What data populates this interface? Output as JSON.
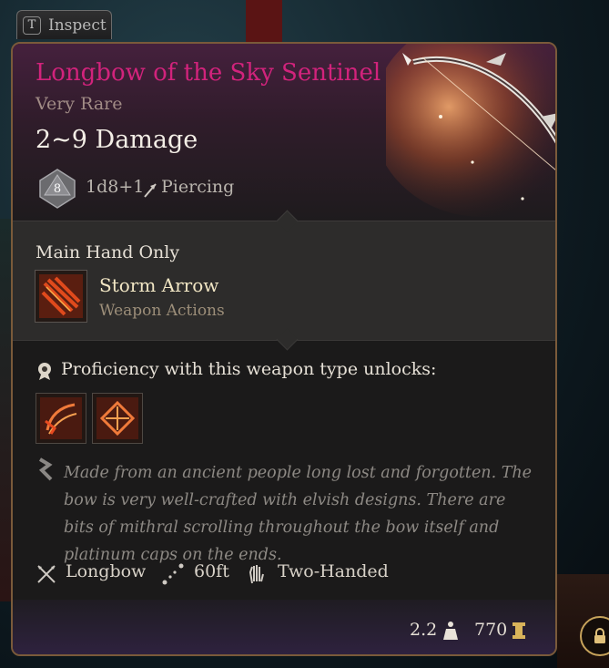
{
  "inspect": {
    "key": "T",
    "label": "Inspect"
  },
  "item": {
    "name": "Longbow of the Sky Sentinel",
    "rarity": "Very Rare",
    "damage": "2~9 Damage",
    "die_face": "8",
    "dice": "1d8+1",
    "damage_type": "Piercing",
    "main_hand_label": "Main Hand Only",
    "action": {
      "name": "Storm Arrow",
      "category": "Weapon Actions"
    },
    "proficiency_text": "Proficiency with this weapon type unlocks:",
    "lore": "Made from an ancient people long lost and forgotten. The bow is very well-crafted with elvish designs. There are bits of mithral scrolling throughout the bow itself and platinum caps on the ends.",
    "properties": {
      "weapon_type": "Longbow",
      "range": "60ft",
      "handedness": "Two-Handed"
    },
    "weight": "2.2",
    "value": "770"
  },
  "colors": {
    "rarity_title": "#d2237c",
    "border": "#7a5a3a",
    "action_name": "#f1e6c4"
  },
  "icons": [
    "d8-die-icon",
    "piercing-icon",
    "bow-item-icon",
    "storm-arrow-icon",
    "proficiency-icon",
    "unlock-action-icon",
    "lore-icon",
    "longbow-type-icon",
    "range-icon",
    "two-handed-icon",
    "weight-icon",
    "gold-icon",
    "lock-icon"
  ]
}
